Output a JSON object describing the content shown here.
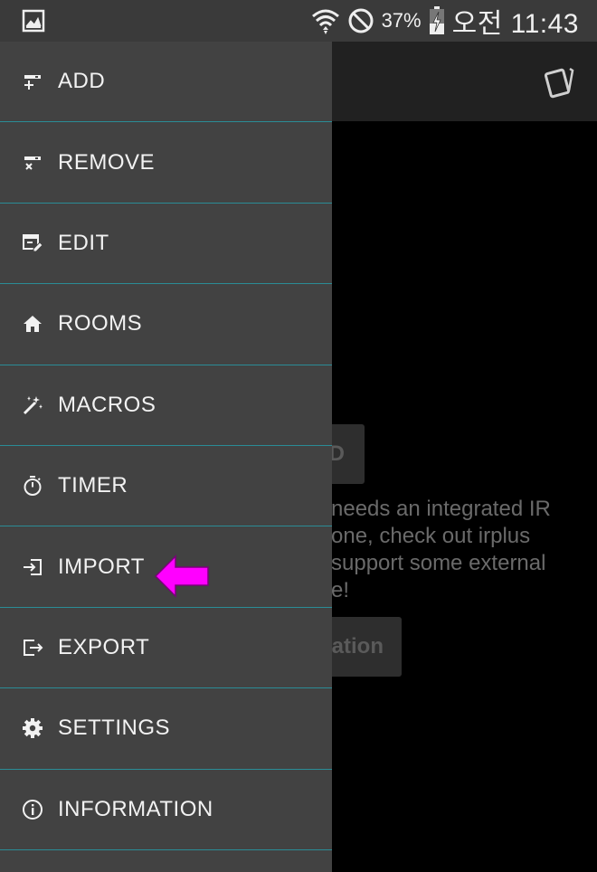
{
  "status_bar": {
    "battery_percent": "37%",
    "time": "오전 11:43",
    "left_icon": "image-icon",
    "icons": [
      "wifi-icon",
      "do-not-disturb-icon",
      "battery-charging-icon"
    ]
  },
  "app_bar": {
    "icon": "cards-icon"
  },
  "background": {
    "button1_label": "D",
    "text_lines": [
      "needs an integrated IR",
      "one, check out irplus",
      "support some external",
      "e!"
    ],
    "button2_label": "ation"
  },
  "drawer": {
    "items": [
      {
        "label": "ADD",
        "icon": "add-remote-icon"
      },
      {
        "label": "REMOVE",
        "icon": "remove-remote-icon"
      },
      {
        "label": "EDIT",
        "icon": "edit-icon"
      },
      {
        "label": "ROOMS",
        "icon": "home-icon"
      },
      {
        "label": "MACROS",
        "icon": "magic-wand-icon"
      },
      {
        "label": "TIMER",
        "icon": "timer-icon"
      },
      {
        "label": "IMPORT",
        "icon": "import-icon"
      },
      {
        "label": "EXPORT",
        "icon": "export-icon"
      },
      {
        "label": "SETTINGS",
        "icon": "gear-icon"
      },
      {
        "label": "INFORMATION",
        "icon": "info-icon"
      }
    ]
  },
  "annotation": {
    "arrow_color": "#ff00ff",
    "points_to": "IMPORT"
  },
  "colors": {
    "drawer_bg": "#424242",
    "divider": "#2a8c96",
    "status_bar_bg": "#3a3a3a",
    "app_bar_bg": "#212121"
  }
}
